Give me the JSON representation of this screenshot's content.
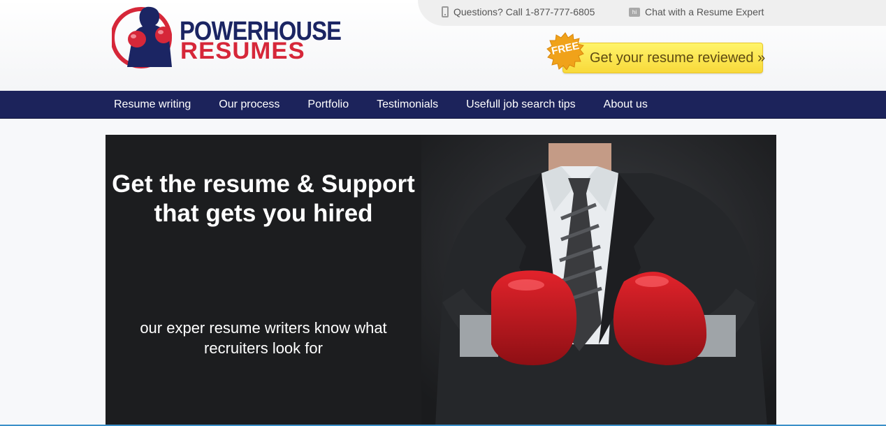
{
  "header": {
    "logo": {
      "line1": "POWERHOUSE",
      "line2": "RESUMES",
      "colors": {
        "navy": "#1b2563",
        "red": "#d62739"
      }
    },
    "contact": {
      "phone_text": "Questions? Call 1-877-777-6805",
      "phone_icon": "mobile-phone-icon",
      "chat_text": "Chat with a Resume Expert",
      "chat_icon": "chat-bubble-icon"
    },
    "cta": {
      "badge": "FREE",
      "label": "Get your resume reviewed »",
      "color": "#f8d93a"
    }
  },
  "nav": {
    "background": "#1c235b",
    "items": [
      {
        "label": "Resume writing"
      },
      {
        "label": "Our process"
      },
      {
        "label": "Portfolio"
      },
      {
        "label": "Testimonials"
      },
      {
        "label": "Usefull job search tips"
      },
      {
        "label": "About us"
      }
    ]
  },
  "hero": {
    "headline_line1": "Get the resume & Support",
    "headline_line2": "that gets you hired",
    "sub_line1": "our exper resume writers know what",
    "sub_line2": "recruiters look for"
  }
}
